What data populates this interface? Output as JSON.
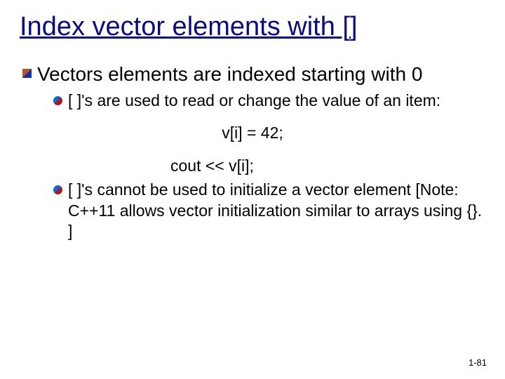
{
  "title": "Index vector elements with []",
  "bullet1": "Vectors elements are indexed starting with 0",
  "sub1": "[ ]'s are used to read or change the value of an item:",
  "code1": "v[i] = 42;",
  "code2": "cout << v[i];",
  "sub2": "[ ]'s cannot be used to initialize a vector element [Note: C++11 allows vector initialization similar to arrays using {}. ]",
  "pageNumber": "1-81"
}
